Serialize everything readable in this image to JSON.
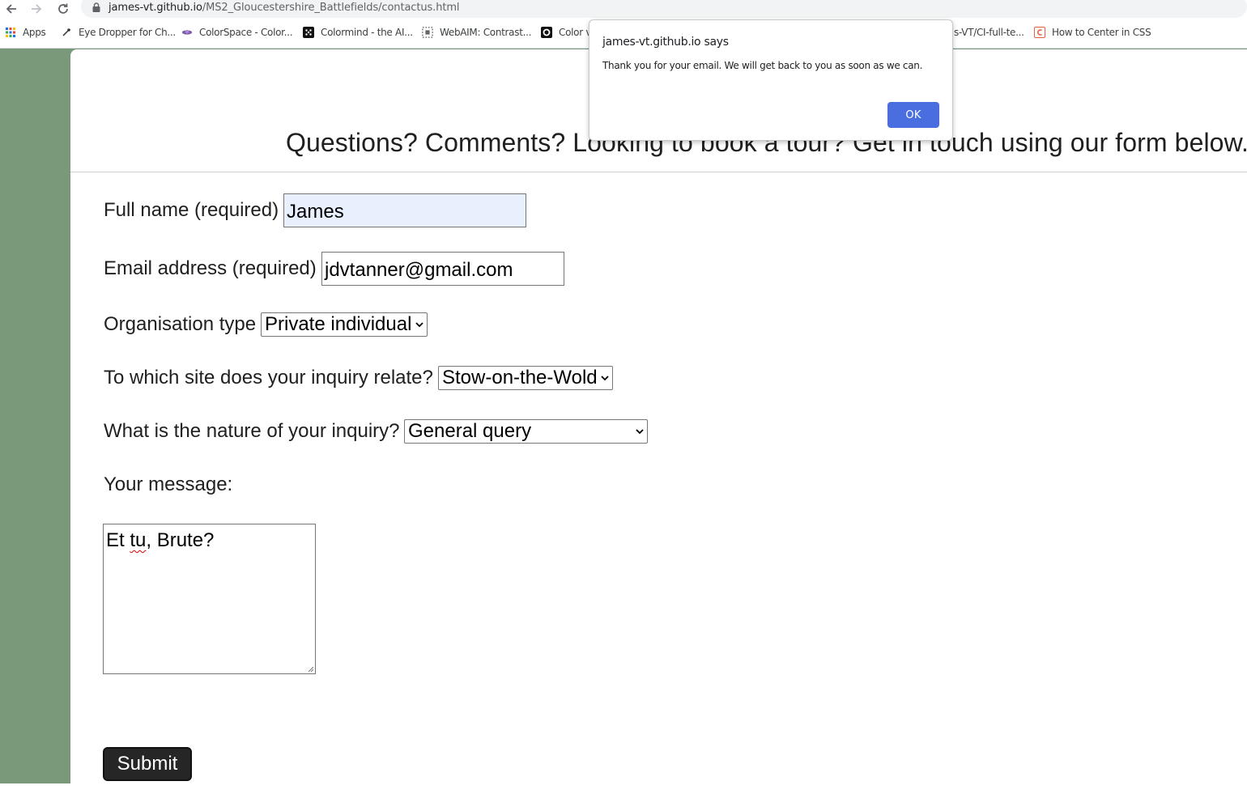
{
  "browser": {
    "url_host": "james-vt.github.io",
    "url_path": "/MS2_Gloucestershire_Battlefields/contactus.html",
    "bookmarks": [
      {
        "label": "Apps",
        "icon": "apps-grid-icon"
      },
      {
        "label": "Eye Dropper for Ch...",
        "icon": "eyedropper-icon"
      },
      {
        "label": "ColorSpace - Color...",
        "icon": "colorspace-icon"
      },
      {
        "label": "Colormind - the AI...",
        "icon": "colormind-icon"
      },
      {
        "label": "WebAIM: Contrast...",
        "icon": "webaim-icon"
      },
      {
        "label": "Color v",
        "icon": "color-icon"
      },
      {
        "label": "s-VT/CI-full-te...",
        "icon": null
      },
      {
        "label": "How to Center in CSS",
        "icon": "css-icon"
      }
    ]
  },
  "page": {
    "heading": "Questions? Comments? Looking to book a tour? Get in touch using our form below.",
    "form": {
      "full_name_label": "Full name (required)",
      "full_name_value": "James",
      "email_label": "Email address (required)",
      "email_value": "jdvtanner@gmail.com",
      "org_type_label": "Organisation type",
      "org_type_value": "Private individual",
      "site_label": "To which site does your inquiry relate?",
      "site_value": "Stow-on-the-Wold",
      "nature_label": "What is the nature of your inquiry?",
      "nature_value": "General query",
      "message_label": "Your message:",
      "message_value_pre": "Et ",
      "message_value_misspelled": "tu",
      "message_value_post": ", Brute?",
      "submit_label": "Submit"
    }
  },
  "dialog": {
    "title": "james-vt.github.io says",
    "message": "Thank you for your email. We will get back to you as soon as we can.",
    "ok_label": "OK"
  },
  "colors": {
    "page_background": "#79997a",
    "dialog_button": "#4a6ee0",
    "submit_button": "#262626",
    "autofill": "#e8f0fe"
  }
}
